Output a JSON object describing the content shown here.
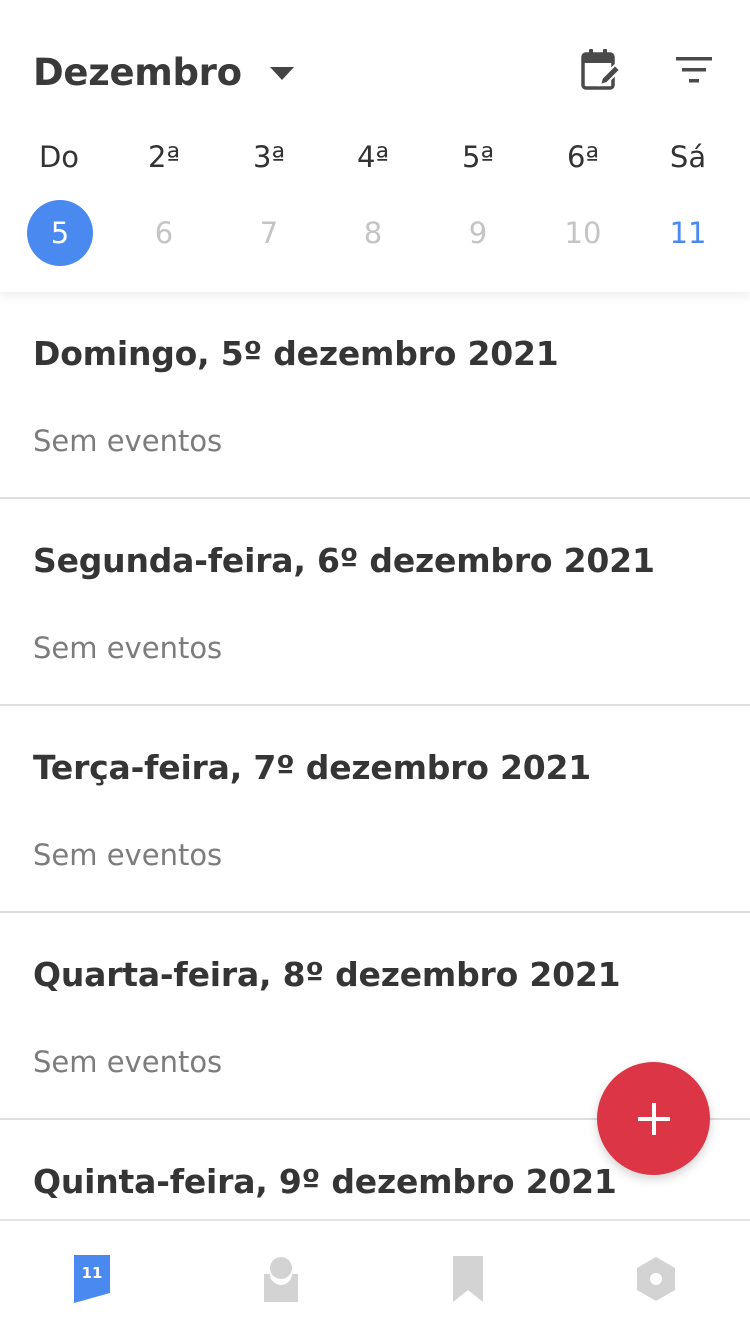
{
  "header": {
    "month_title": "Dezembro",
    "calendar_edit_icon": "calendar-edit-icon",
    "filter_icon": "filter-icon"
  },
  "week": {
    "weekdays": [
      "Do",
      "2ª",
      "3ª",
      "4ª",
      "5ª",
      "6ª",
      "Sá"
    ],
    "dates": [
      "5",
      "6",
      "7",
      "8",
      "9",
      "10",
      "11"
    ],
    "selected_index": 0
  },
  "days": [
    {
      "title": "Domingo, 5º dezembro 2021",
      "empty_label": "Sem eventos"
    },
    {
      "title": "Segunda-feira, 6º dezembro 2021",
      "empty_label": "Sem eventos"
    },
    {
      "title": "Terça-feira, 7º dezembro 2021",
      "empty_label": "Sem eventos"
    },
    {
      "title": "Quarta-feira, 8º dezembro 2021",
      "empty_label": "Sem eventos"
    },
    {
      "title": "Quinta-feira, 9º dezembro 2021",
      "empty_label": ""
    }
  ],
  "fab": {
    "icon": "plus-icon"
  },
  "bottom_nav": {
    "items": [
      {
        "icon": "calendar-icon",
        "badge": "11",
        "active": true
      },
      {
        "icon": "contact-icon",
        "active": false
      },
      {
        "icon": "bookmark-icon",
        "active": false
      },
      {
        "icon": "settings-hexagon-icon",
        "active": false
      }
    ]
  },
  "colors": {
    "accent": "#4a89f0",
    "fab": "#dc3545",
    "text_primary": "#353535",
    "text_secondary": "#7c7c7c",
    "date_muted": "#c4c4c4",
    "nav_inactive": "#d3d3d3"
  }
}
